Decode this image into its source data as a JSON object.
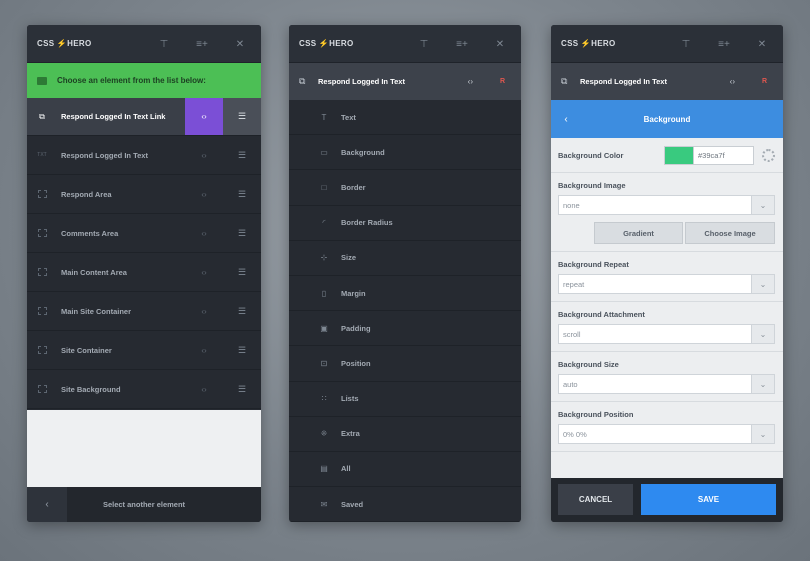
{
  "brand": {
    "logo_left": "CSS",
    "logo_bolt": "⚡",
    "logo_right": "HERO"
  },
  "header_icons": [
    "pin-icon",
    "add-list-icon",
    "close-icon"
  ],
  "panel1": {
    "banner": "Choose an element from the list below:",
    "elements": [
      {
        "label": "Respond Logged In Text Link",
        "icon": "external-link-icon",
        "active": true
      },
      {
        "label": "Respond Logged In Text",
        "icon": "text-icon"
      },
      {
        "label": "Respond Area",
        "icon": "box-icon"
      },
      {
        "label": "Comments Area",
        "icon": "box-icon"
      },
      {
        "label": "Main Content Area",
        "icon": "box-icon"
      },
      {
        "label": "Main Site Container",
        "icon": "box-icon"
      },
      {
        "label": "Site Container",
        "icon": "box-icon"
      },
      {
        "label": "Site Background",
        "icon": "box-icon"
      }
    ],
    "footer": "Select another element"
  },
  "panel2": {
    "selected": "Respond Logged In Text",
    "reset": "R",
    "properties": [
      "Text",
      "Background",
      "Border",
      "Border Radius",
      "Size",
      "Margin",
      "Padding",
      "Position",
      "Lists",
      "Extra",
      "All",
      "Saved"
    ]
  },
  "panel3": {
    "selected": "Respond Logged In Text",
    "reset": "R",
    "title": "Background",
    "color_label": "Background Color",
    "color_value": "#39ca7f",
    "color_hex": "#39ca7f",
    "image_label": "Background Image",
    "image_value": "none",
    "gradient_btn": "Gradient",
    "choose_btn": "Choose Image",
    "repeat_label": "Background Repeat",
    "repeat_value": "repeat",
    "attachment_label": "Background Attachment",
    "attachment_value": "scroll",
    "size_label": "Background Size",
    "size_value": "auto",
    "position_label": "Background Position",
    "position_value": "0% 0%",
    "cancel": "CANCEL",
    "save": "SAVE"
  },
  "colors": {
    "banner_green": "#4cbf55",
    "active_purple": "#7b4fd6",
    "accent_blue": "#3d8de0",
    "save_blue": "#2e8af0",
    "reset_red": "#e0574f",
    "panel_dark": "#262a31"
  }
}
